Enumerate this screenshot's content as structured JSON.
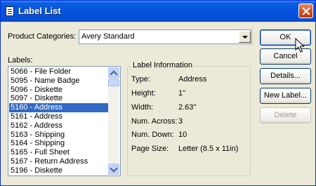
{
  "window": {
    "title": "Label List"
  },
  "category": {
    "label": "Product Categories:",
    "value": "Avery Standard"
  },
  "labels": {
    "caption": "Labels:",
    "items": [
      "5066 - File Folder",
      "5095 - Name Badge",
      "5096 - Diskette",
      "5097 - Diskette",
      "5160 - Address",
      "5161 - Address",
      "5162 - Address",
      "5163 - Shipping",
      "5164 - Shipping",
      "5165 - Full Sheet",
      "5167 - Return Address",
      "5196 - Diskette"
    ],
    "selected_index": 4
  },
  "info": {
    "title": "Label Information",
    "rows": [
      {
        "label": "Type:",
        "value": "Address"
      },
      {
        "label": "Height:",
        "value": "1''"
      },
      {
        "label": "Width:",
        "value": "2.63''"
      },
      {
        "label": "Num. Across:",
        "value": "3"
      },
      {
        "label": "Num. Down:",
        "value": "10"
      },
      {
        "label": "Page Size:",
        "value": "Letter (8.5 x 11in)"
      }
    ]
  },
  "buttons": {
    "ok": "OK",
    "cancel": "Cancel",
    "details": "Details...",
    "new_label": "New Label...",
    "delete": "Delete"
  },
  "icons": {
    "app": "label-list-icon",
    "close": "close-icon",
    "cursor": "mouse-pointer-icon"
  }
}
